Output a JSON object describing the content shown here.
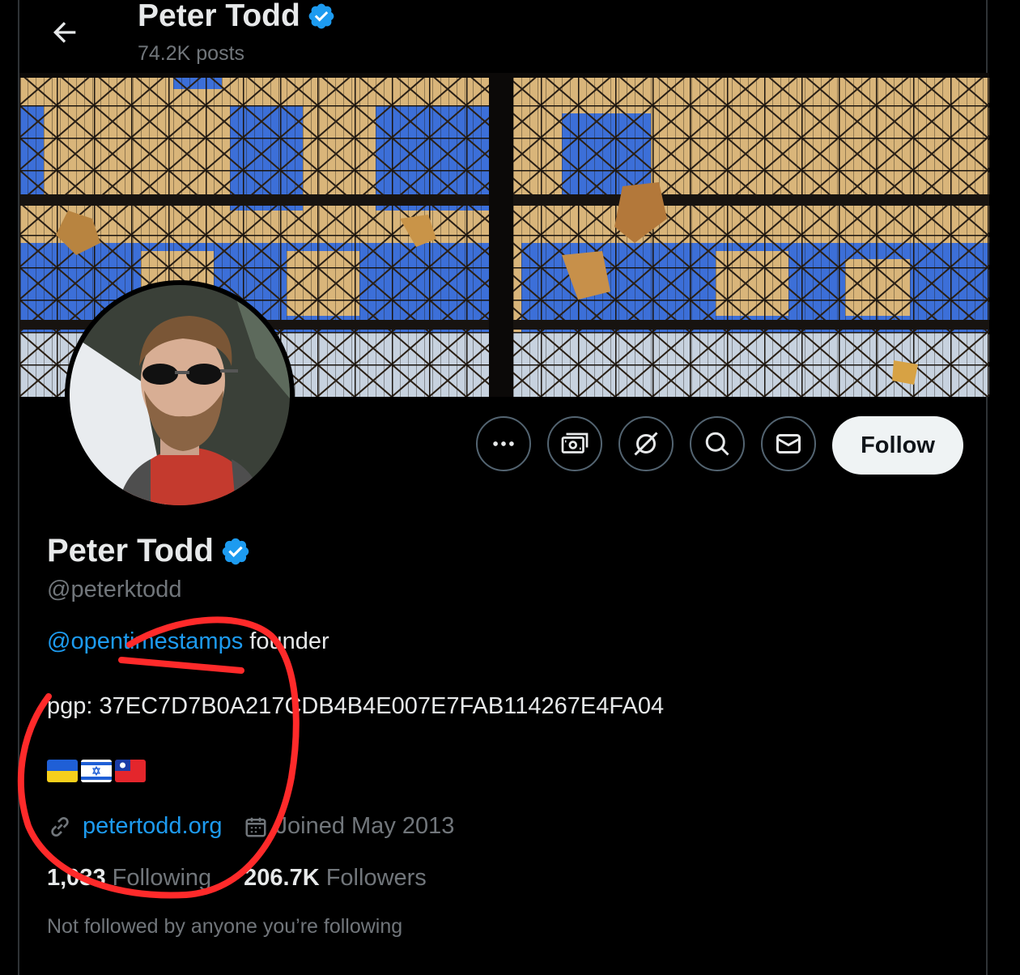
{
  "header": {
    "name": "Peter Todd",
    "posts_count": "74.2K posts"
  },
  "profile": {
    "name": "Peter Todd",
    "handle": "@peterktodd",
    "bio_mention": "@opentimestamps",
    "bio_suffix": " founder",
    "bio_pgp": "pgp: 37EC7D7B0A217CDB4B4E007E7FAB114267E4FA04",
    "flags": [
      "ukraine-flag",
      "israel-flag",
      "taiwan-flag"
    ],
    "website": "petertodd.org",
    "joined": "Joined May 2013",
    "following_count": "1,033",
    "following_label": "Following",
    "followers_count": "206.7K",
    "followers_label": "Followers",
    "not_followed_text": "Not followed by anyone you’re following"
  },
  "actions": {
    "more_icon": "more-icon",
    "subscribe_icon": "money-icon",
    "grok_icon": "grok-icon",
    "search_icon": "search-icon",
    "message_icon": "mail-icon",
    "follow_label": "Follow"
  },
  "colors": {
    "verified": "#1d9bf0",
    "link": "#1d9bf0",
    "muted": "#71767b",
    "annotation": "#ff2a2a"
  }
}
